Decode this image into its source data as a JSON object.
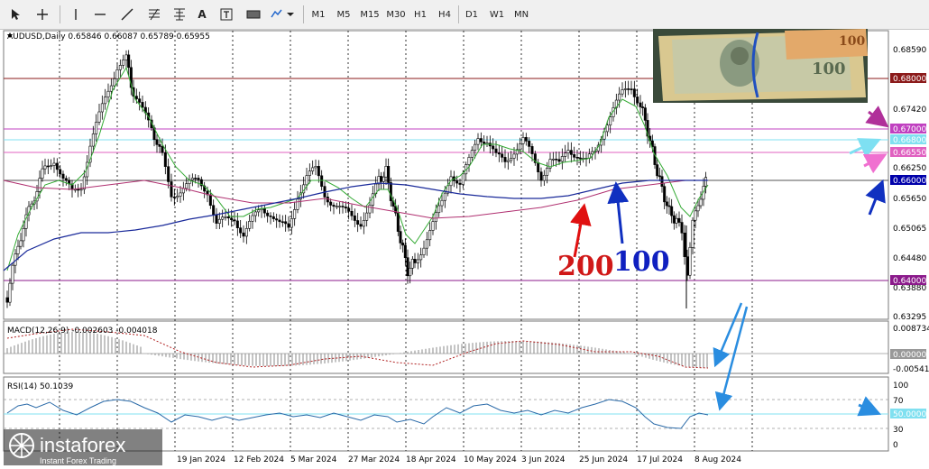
{
  "toolbar": {
    "tools": [
      "cursor-icon",
      "crosshair-icon",
      "vertical-line-icon",
      "horizontal-line-icon",
      "trend-line-icon",
      "fibonacci-icon",
      "channel-icon",
      "text-tool-icon",
      "text-label-icon",
      "rectangle-icon",
      "shapes-icon"
    ],
    "text_tool": "A",
    "timeframes": [
      "M1",
      "M5",
      "M15",
      "M30",
      "H1",
      "H4",
      "D1",
      "W1",
      "MN"
    ]
  },
  "chart": {
    "header": "AUDUSD,Daily  0.65846 0.66087 0.65789 0.65955",
    "price_ticks": [
      "0.68590",
      "0.67420",
      "0.66250",
      "0.65650",
      "0.65065",
      "0.64480",
      "0.63880",
      "0.63295"
    ],
    "levels": [
      {
        "label": "0.68000",
        "bg": "#8b1a1a",
        "line": "#8b1a1a"
      },
      {
        "label": "0.67000",
        "bg": "#c040c0",
        "line": "#c040c0"
      },
      {
        "label": "0.66800",
        "bg": "#80e0f0",
        "line": "#80e0f0"
      },
      {
        "label": "0.66550",
        "bg": "#e060c0",
        "line": "#e060c0"
      },
      {
        "label": "0.66000",
        "bg": "#0000aa",
        "line": "#555555"
      },
      {
        "label": "0.64000",
        "bg": "#8b1a8b",
        "line": "#8b1a8b"
      }
    ],
    "date_labels": [
      "19 Jan 2024",
      "12 Feb 2024",
      "5 Mar 2024",
      "27 Mar 2024",
      "18 Apr 2024",
      "10 May 2024",
      "3 Jun 2024",
      "25 Jun 2024",
      "17 Jul 2024",
      "8 Aug 2024"
    ],
    "ma_labels": {
      "ma200": "200",
      "ma100": "100"
    },
    "colors": {
      "ma200": "#ff0000",
      "ma100": "#0000cc",
      "ma_fast": "#33aa33",
      "ma_purple": "#b03070",
      "bull": "#000000",
      "bear": "#000000"
    }
  },
  "macd": {
    "label": "MACD(12,26,9) -0.002603 -0.004018",
    "ticks": [
      "0.008734",
      "0.00000",
      "-0.00541"
    ]
  },
  "rsi": {
    "label": "RSI(14) 50.1039",
    "ticks": [
      "100",
      "70",
      "50",
      "30",
      "0"
    ],
    "current": "50.0000"
  },
  "watermark": {
    "brand": "instaforex",
    "tagline": "Instant Forex Trading"
  },
  "banknote": {
    "value": "100"
  }
}
